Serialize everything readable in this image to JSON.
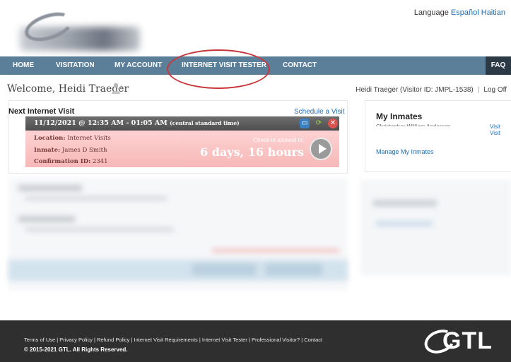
{
  "header": {
    "language_label": "Language",
    "languages": [
      "Español",
      "Haitian"
    ]
  },
  "nav": {
    "items": [
      "HOME",
      "VISITATION",
      "MY ACCOUNT",
      "INTERNET VISIT TESTER",
      "CONTACT"
    ],
    "faq": "FAQ"
  },
  "welcome": {
    "text": "Welcome, Heidi Traeger",
    "visitor": "Heidi Traeger (Visitor ID: JMPL-1538)",
    "log_off": "Log Off"
  },
  "next_visit": {
    "title": "Next Internet Visit",
    "schedule_link": "Schedule a Visit",
    "datetime": "11/12/2021 @ 12:35 AM - 01:05 AM",
    "timezone": "(central standard time)",
    "location_label": "Location:",
    "location": "Internet Visits",
    "inmate_label": "Inmate:",
    "inmate": "James D Smith",
    "confirmation_label": "Confirmation ID:",
    "confirmation": "2341",
    "checkin_label": "Check-in allowed in:",
    "checkin_value": "6 days, 16 hours"
  },
  "my_inmates": {
    "title": "My Inmates",
    "inmate_name": "Christopher William Anderson",
    "visit_labels": [
      "Visit",
      "Visit"
    ],
    "manage_link": "Manage My Inmates"
  },
  "footer": {
    "links": "Terms of Use | Privacy Policy | Refund Policy | Internet Visit Requirements | Internet Visit Tester | Professional Visitor? | Contact",
    "copyright": "© 2015-2021 GTL. All Rights Reserved.",
    "logo_text": "GTL"
  }
}
